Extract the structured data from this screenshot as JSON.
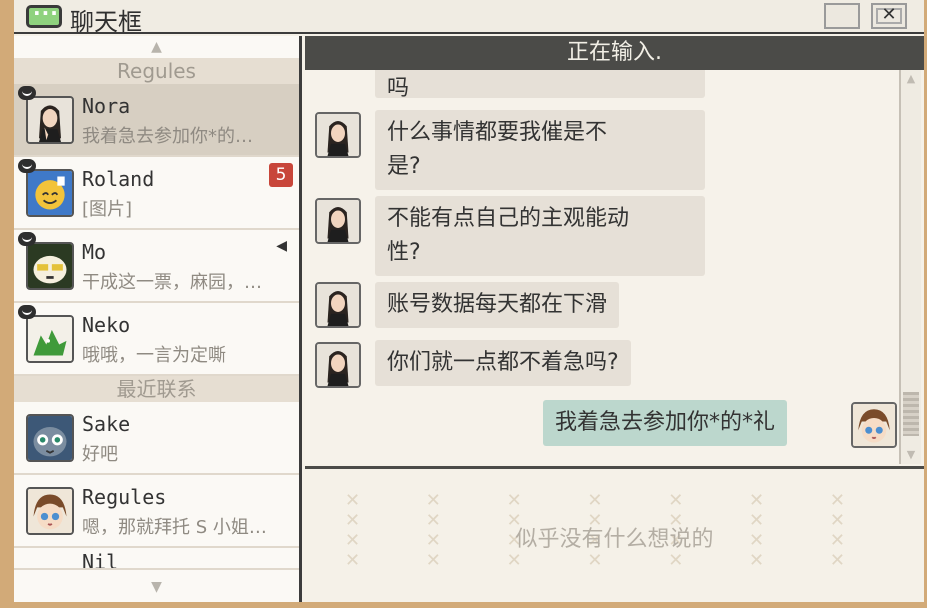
{
  "window": {
    "title": "聊天框"
  },
  "contacts": {
    "section_top": "Regules",
    "section_recent": "最近联系",
    "items": [
      {
        "name": "Nora",
        "preview": "我着急去参加你*的…",
        "active": true,
        "badge": ""
      },
      {
        "name": "Roland",
        "preview": "[图片]",
        "active": false,
        "badge": "5"
      },
      {
        "name": "Mo",
        "preview": "干成这一票，麻园，…",
        "active": false,
        "badge": ""
      },
      {
        "name": "Neko",
        "preview": "哦哦，一言为定嘶",
        "active": false,
        "badge": ""
      }
    ],
    "recent": [
      {
        "name": "Sake",
        "preview": "好吧"
      },
      {
        "name": "Regules",
        "preview": "嗯，那就拜托 S 小姐…"
      },
      {
        "name": "Nil",
        "preview": ""
      }
    ]
  },
  "chat": {
    "header": "正在输入.",
    "messages": [
      {
        "from": "other",
        "text": "吗"
      },
      {
        "from": "other",
        "text_lines": [
          "什么事情都要我催是不",
          "是?"
        ]
      },
      {
        "from": "other",
        "text_lines": [
          "不能有点自己的主观能动",
          "性?"
        ]
      },
      {
        "from": "other",
        "text": "账号数据每天都在下滑"
      },
      {
        "from": "other",
        "text": "你们就一点都不着急吗?"
      },
      {
        "from": "me",
        "text": "我着急去参加你*的*礼"
      }
    ],
    "input_placeholder": "似乎没有什么想说的"
  },
  "icons": {
    "title": "chat-bubble-icon",
    "presence": "smile-badge-icon",
    "speaker": "speaker-icon",
    "scroll_up": "triangle-up-icon",
    "scroll_down": "triangle-down-icon"
  },
  "colors": {
    "header_bg": "#4b4b48",
    "active_row": "#d7cfc2",
    "my_bubble": "#bcd7cd",
    "their_bubble": "#e6e0d7",
    "badge": "#c8463a"
  }
}
